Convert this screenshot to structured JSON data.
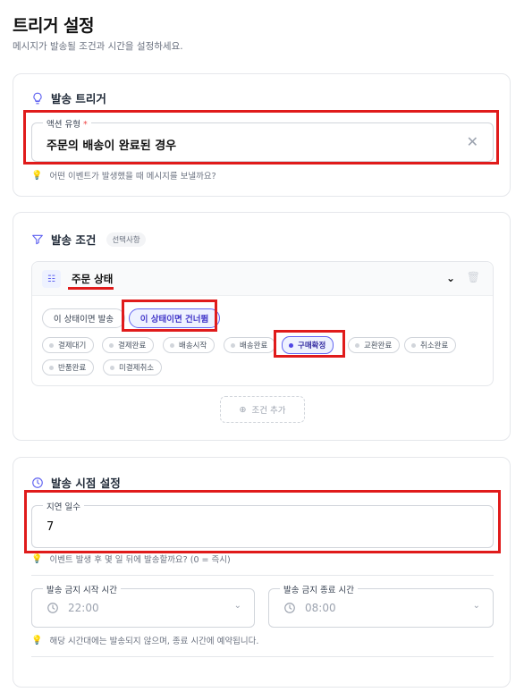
{
  "page": {
    "title": "트리거 설정",
    "subtitle": "메시지가 발송될 조건과 시간을 설정하세요."
  },
  "trigger": {
    "heading": "발송 트리거",
    "icon": "lightbulb-icon",
    "field_label": "액션 유형",
    "required_mark": "*",
    "value": "주문의 배송이 완료된 경우",
    "clear_icon": "close-icon",
    "hint": "어떤 이벤트가 발생했을 때 메시지를 보낼까요?"
  },
  "conditions": {
    "heading": "발송 조건",
    "icon": "filter-icon",
    "badge": "선택사항",
    "condition": {
      "label": "주문 상태",
      "icon": "list-check-icon",
      "modes": [
        {
          "label": "이 상태이면 발송",
          "active": false
        },
        {
          "label": "이 상태이면 건너뜀",
          "active": true
        }
      ],
      "statuses": [
        {
          "label": "결제대기",
          "selected": false
        },
        {
          "label": "결제완료",
          "selected": false
        },
        {
          "label": "배송시작",
          "selected": false
        },
        {
          "label": "배송완료",
          "selected": false
        },
        {
          "label": "구매확정",
          "selected": true
        },
        {
          "label": "교환완료",
          "selected": false
        },
        {
          "label": "취소완료",
          "selected": false
        },
        {
          "label": "반품완료",
          "selected": false
        },
        {
          "label": "미결제취소",
          "selected": false
        }
      ]
    },
    "add_label": "조건 추가"
  },
  "timing": {
    "heading": "발송 시점 설정",
    "icon": "clock-icon",
    "delay_label": "지연 일수",
    "delay_value": "7",
    "delay_hint": "이벤트 발생 후 몇 일 뒤에 발송할까요? (0 = 즉시)",
    "quiet_start_label": "발송 금지 시작 시간",
    "quiet_start_value": "22:00",
    "quiet_end_label": "발송 금지 종료 시간",
    "quiet_end_value": "08:00",
    "quiet_hint": "해당 시간대에는 발송되지 않으며, 종료 시간에 예약됩니다."
  },
  "colors": {
    "accent": "#6366f1",
    "highlight": "#e01b1b"
  }
}
